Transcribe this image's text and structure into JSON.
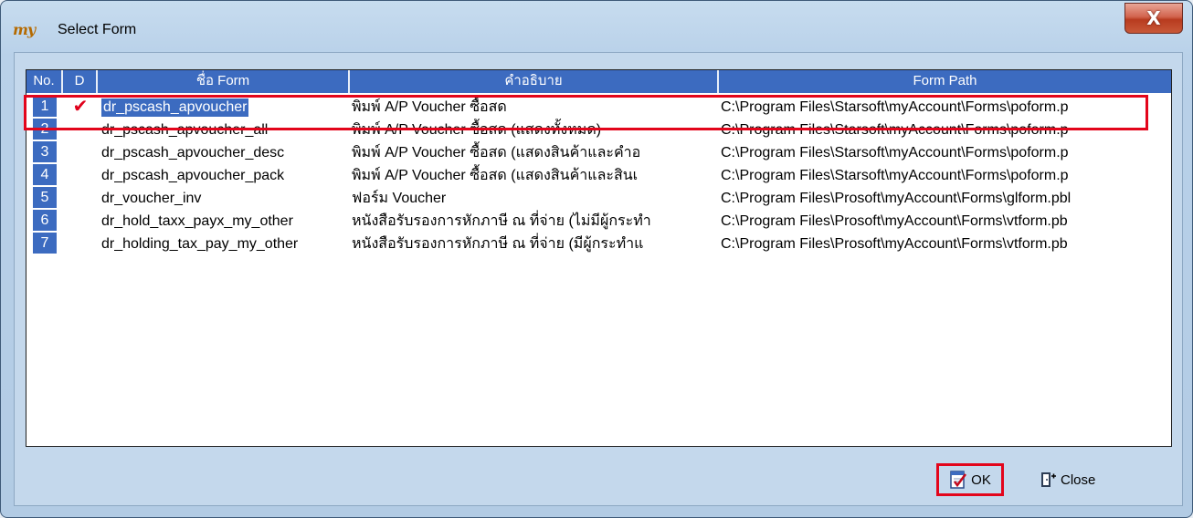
{
  "window": {
    "title": "Select Form",
    "app_icon": "my",
    "close_label": "X"
  },
  "grid": {
    "columns": [
      "No.",
      "D",
      "ชื่อ Form",
      "คำอธิบาย",
      "Form Path"
    ],
    "rows": [
      {
        "no": "1",
        "d": "✔",
        "name": "dr_pscash_apvoucher",
        "desc": "พิมพ์ A/P Voucher ซื้อสด",
        "path": "C:\\Program Files\\Starsoft\\myAccount\\Forms\\poform.p"
      },
      {
        "no": "2",
        "d": "",
        "name": "dr_pscash_apvoucher_all",
        "desc": "พิมพ์ A/P Voucher ซื้อสด (แสดงทั้งหมด)",
        "path": "C:\\Program Files\\Starsoft\\myAccount\\Forms\\poform.p"
      },
      {
        "no": "3",
        "d": "",
        "name": "dr_pscash_apvoucher_desc",
        "desc": "พิมพ์ A/P Voucher ซื้อสด (แสดงสินค้าและคำอ",
        "path": "C:\\Program Files\\Starsoft\\myAccount\\Forms\\poform.p"
      },
      {
        "no": "4",
        "d": "",
        "name": "dr_pscash_apvoucher_pack",
        "desc": "พิมพ์ A/P Voucher ซื้อสด (แสดงสินค้าและสินเ",
        "path": "C:\\Program Files\\Starsoft\\myAccount\\Forms\\poform.p"
      },
      {
        "no": "5",
        "d": "",
        "name": "dr_voucher_inv",
        "desc": "ฟอร์ม Voucher",
        "path": "C:\\Program Files\\Prosoft\\myAccount\\Forms\\glform.pbl"
      },
      {
        "no": "6",
        "d": "",
        "name": "dr_hold_taxx_payx_my_other",
        "desc": "หนังสือรับรองการหักภาษี ณ ที่จ่าย (ไม่มีผู้กระทำ",
        "path": "C:\\Program Files\\Prosoft\\myAccount\\Forms\\vtform.pb"
      },
      {
        "no": "7",
        "d": "",
        "name": "dr_holding_tax_pay_my_other",
        "desc": "หนังสือรับรองการหักภาษี ณ ที่จ่าย (มีผู้กระทำแ",
        "path": "C:\\Program Files\\Prosoft\\myAccount\\Forms\\vtform.pb"
      }
    ]
  },
  "buttons": {
    "ok": "OK",
    "close": "Close"
  },
  "colors": {
    "accent": "#3c6bc0",
    "highlight": "#e3051b",
    "check": "#e0001b"
  }
}
